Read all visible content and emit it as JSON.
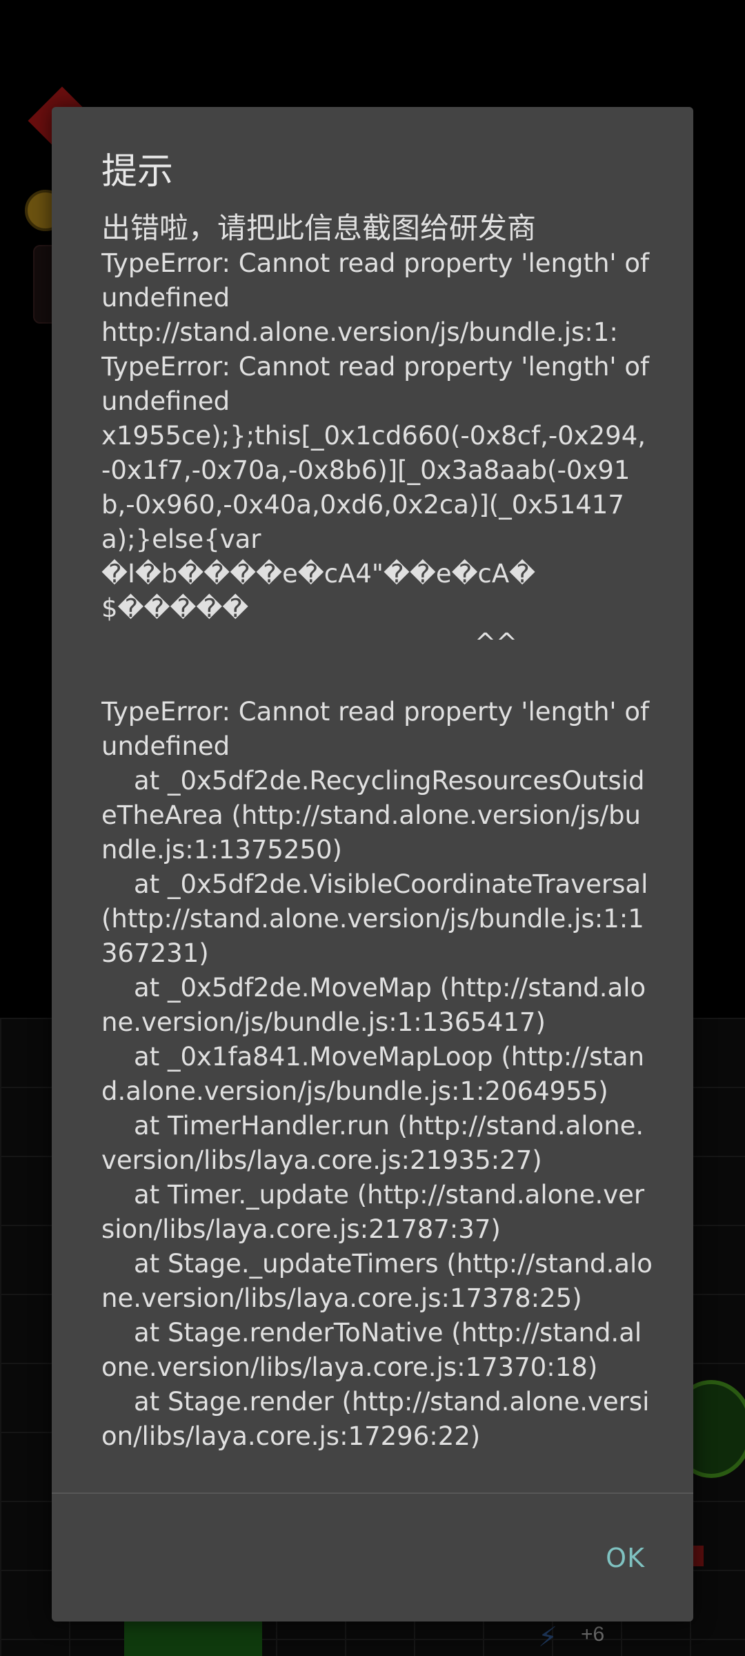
{
  "dialog": {
    "title": "提示",
    "headline": "出错啦，请把此信息截图给研发商",
    "body": "TypeError: Cannot read property 'length' of undefined\nhttp://stand.alone.version/js/bundle.js:1:\nTypeError: Cannot read property 'length' of undefined\nx1955ce);};this[_0x1cd660(-0x8cf,-0x294,-0x1f7,-0x70a,-0x8b6)][_0x3a8aab(-0x91b,-0x960,-0x40a,0xd6,0x2ca)](_0x51417a);}else{var \n�I�b����e�cA4\"��e�cA�\n$�����\n                                              ^^\n\nTypeError: Cannot read property 'length' of undefined\n    at _0x5df2de.RecyclingResourcesOutsideTheArea (http://stand.alone.version/js/bundle.js:1:1375250)\n    at _0x5df2de.VisibleCoordinateTraversal (http://stand.alone.version/js/bundle.js:1:1367231)\n    at _0x5df2de.MoveMap (http://stand.alone.version/js/bundle.js:1:1365417)\n    at _0x1fa841.MoveMapLoop (http://stand.alone.version/js/bundle.js:1:2064955)\n    at TimerHandler.run (http://stand.alone.version/libs/laya.core.js:21935:27)\n    at Timer._update (http://stand.alone.version/libs/laya.core.js:21787:37)\n    at Stage._updateTimers (http://stand.alone.version/libs/laya.core.js:17378:25)\n    at Stage.renderToNative (http://stand.alone.version/libs/laya.core.js:17370:18)\n    at Stage.render (http://stand.alone.version/libs/laya.core.js:17296:22)",
    "ok_label": "OK"
  },
  "background": {
    "score_text": "+6"
  },
  "colors": {
    "dialog_bg": "#444444",
    "text": "#e0e0e0",
    "accent": "#7fc2c1",
    "backdrop": "#000000"
  }
}
